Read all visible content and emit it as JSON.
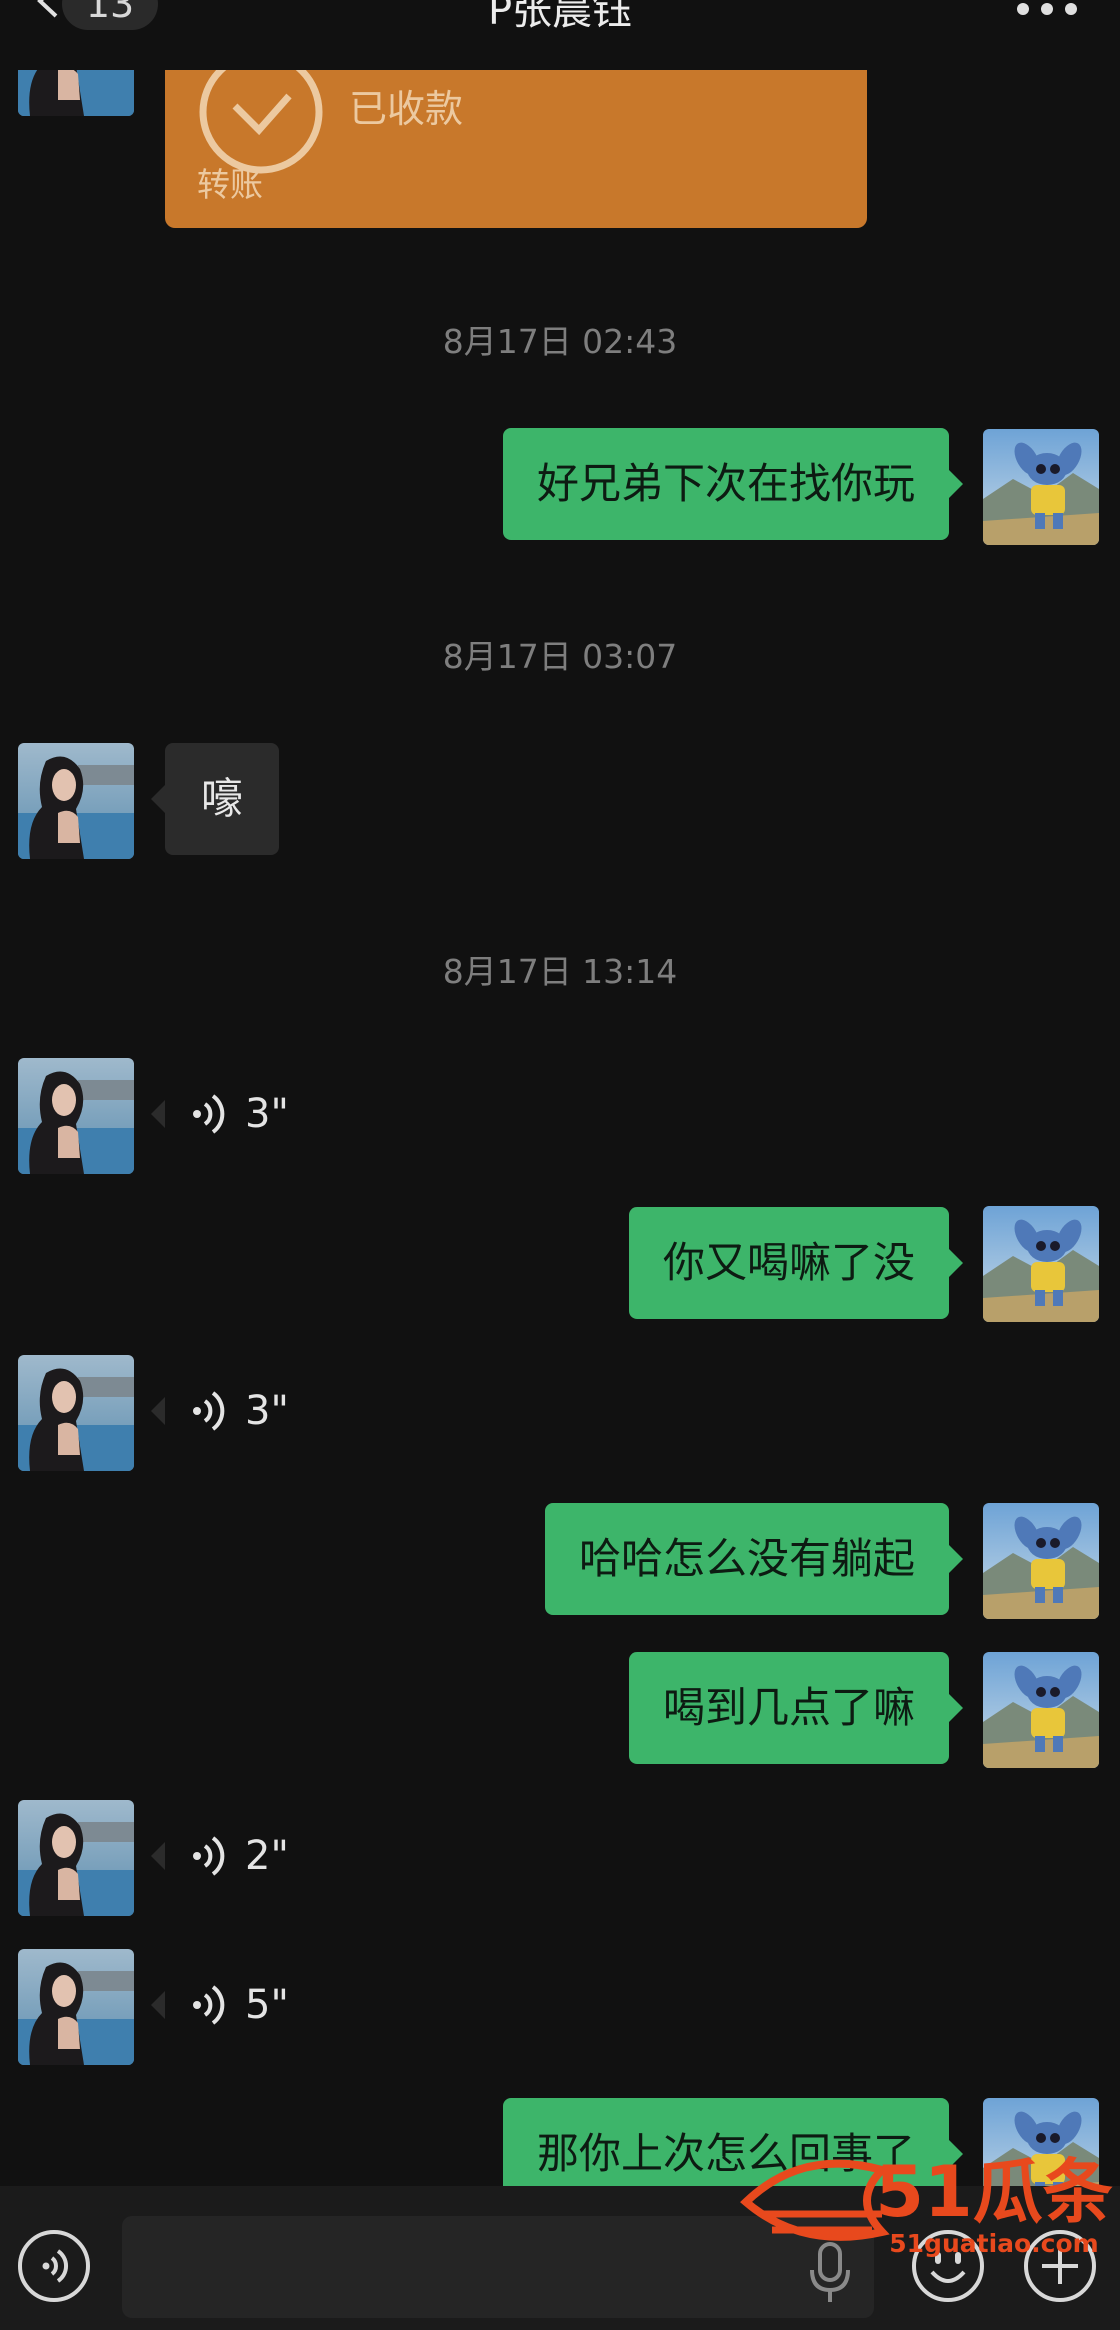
{
  "header": {
    "back_icon": "chevron-left-icon",
    "unread_count": "13",
    "title": "P张晨钰",
    "more_icon": "more-dots-icon"
  },
  "transfer": {
    "status": "已收款",
    "label": "转账",
    "icon": "check-circle-icon",
    "color": "#c8782b"
  },
  "messages": [
    {
      "type": "timestamp",
      "text": "8月17日 02:43"
    },
    {
      "type": "text",
      "side": "right",
      "text": "好兄弟下次在找你玩"
    },
    {
      "type": "timestamp",
      "text": "8月17日 03:07"
    },
    {
      "type": "text",
      "side": "left",
      "text": "嚎"
    },
    {
      "type": "timestamp",
      "text": "8月17日 13:14"
    },
    {
      "type": "voice",
      "side": "left",
      "duration": "3\""
    },
    {
      "type": "text",
      "side": "right",
      "text": "你又喝嘛了没"
    },
    {
      "type": "voice",
      "side": "left",
      "duration": "3\""
    },
    {
      "type": "text",
      "side": "right",
      "text": "哈哈怎么没有躺起"
    },
    {
      "type": "text",
      "side": "right",
      "text": "喝到几点了嘛"
    },
    {
      "type": "voice",
      "side": "left",
      "duration": "2\""
    },
    {
      "type": "voice",
      "side": "left",
      "duration": "5\""
    },
    {
      "type": "text",
      "side": "right",
      "text": "那你上次怎么回事了"
    }
  ],
  "inputbar": {
    "voice_toggle_icon": "voice-mode-icon",
    "mic_icon": "microphone-icon",
    "emoji_icon": "emoji-icon",
    "plus_icon": "plus-icon"
  },
  "watermark": {
    "brand": "51瓜条",
    "url": "51guatiao.com"
  },
  "colors": {
    "background": "#111111",
    "sent_bubble": "#3db56a",
    "received_bubble": "#2b2b2b",
    "watermark": "#e8491d"
  }
}
